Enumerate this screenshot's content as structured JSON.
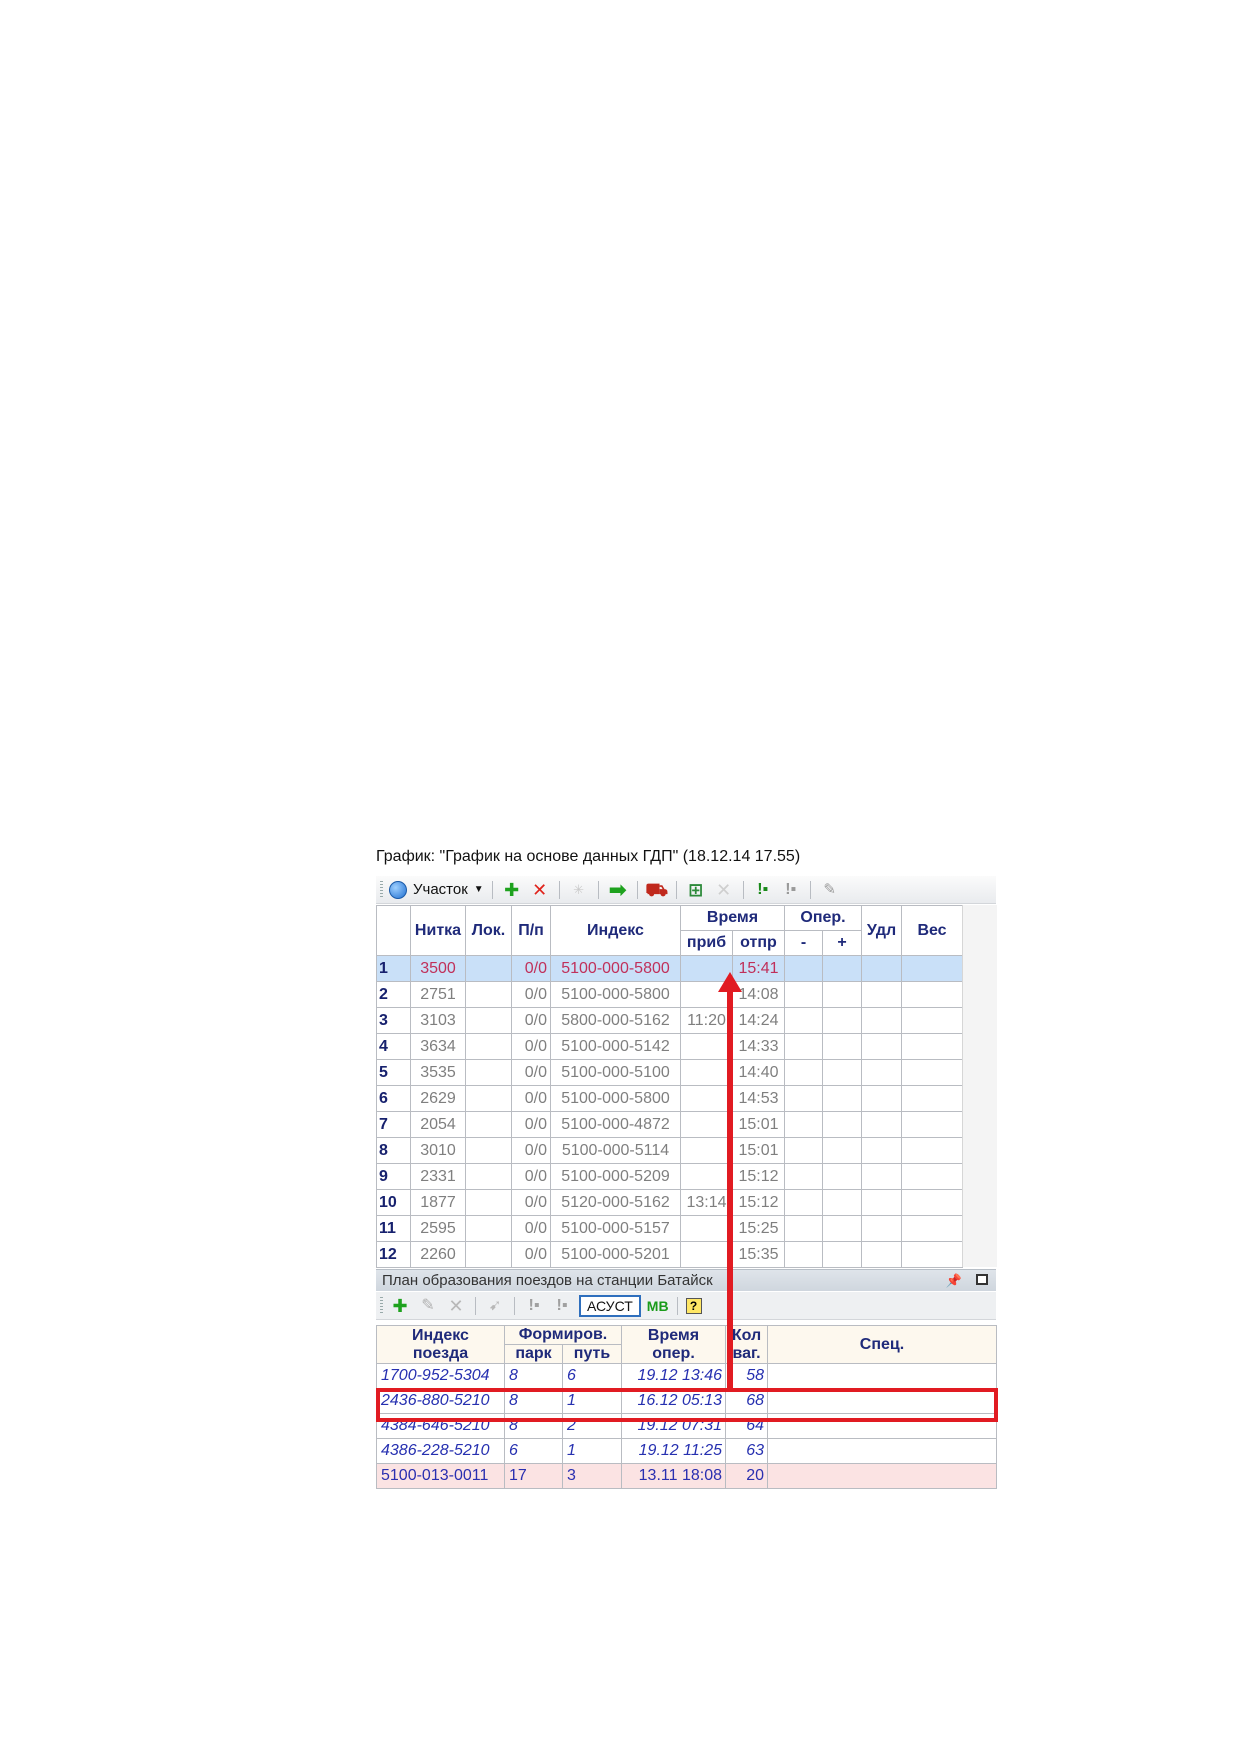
{
  "window": {
    "title": "График: \"График на основе данных ГДП\" (18.12.14 17.55)"
  },
  "toolbar": {
    "section_label": "Участок"
  },
  "trains_table": {
    "headers": {
      "nitka": "Нитка",
      "lok": "Лок.",
      "pp": "П/п",
      "index": "Индекс",
      "time": "Время",
      "arrival": "приб",
      "departure": "отпр",
      "oper": "Опер.",
      "oper_minus": "-",
      "oper_plus": "+",
      "udl": "Удл",
      "ves": "Вес"
    },
    "rows": [
      {
        "num": "1",
        "nitka": "3500",
        "lok": "",
        "pp": "0/0",
        "index": "5100-000-5800",
        "arrival": "",
        "departure": "15:41",
        "minus": "",
        "plus": "",
        "udl": "",
        "ves": ""
      },
      {
        "num": "2",
        "nitka": "2751",
        "lok": "",
        "pp": "0/0",
        "index": "5100-000-5800",
        "arrival": "",
        "departure": "14:08",
        "minus": "",
        "plus": "",
        "udl": "",
        "ves": ""
      },
      {
        "num": "3",
        "nitka": "3103",
        "lok": "",
        "pp": "0/0",
        "index": "5800-000-5162",
        "arrival": "11:20",
        "departure": "14:24",
        "minus": "",
        "plus": "",
        "udl": "",
        "ves": ""
      },
      {
        "num": "4",
        "nitka": "3634",
        "lok": "",
        "pp": "0/0",
        "index": "5100-000-5142",
        "arrival": "",
        "departure": "14:33",
        "minus": "",
        "plus": "",
        "udl": "",
        "ves": ""
      },
      {
        "num": "5",
        "nitka": "3535",
        "lok": "",
        "pp": "0/0",
        "index": "5100-000-5100",
        "arrival": "",
        "departure": "14:40",
        "minus": "",
        "plus": "",
        "udl": "",
        "ves": ""
      },
      {
        "num": "6",
        "nitka": "2629",
        "lok": "",
        "pp": "0/0",
        "index": "5100-000-5800",
        "arrival": "",
        "departure": "14:53",
        "minus": "",
        "plus": "",
        "udl": "",
        "ves": ""
      },
      {
        "num": "7",
        "nitka": "2054",
        "lok": "",
        "pp": "0/0",
        "index": "5100-000-4872",
        "arrival": "",
        "departure": "15:01",
        "minus": "",
        "plus": "",
        "udl": "",
        "ves": ""
      },
      {
        "num": "8",
        "nitka": "3010",
        "lok": "",
        "pp": "0/0",
        "index": "5100-000-5114",
        "arrival": "",
        "departure": "15:01",
        "minus": "",
        "plus": "",
        "udl": "",
        "ves": ""
      },
      {
        "num": "9",
        "nitka": "2331",
        "lok": "",
        "pp": "0/0",
        "index": "5100-000-5209",
        "arrival": "",
        "departure": "15:12",
        "minus": "",
        "plus": "",
        "udl": "",
        "ves": ""
      },
      {
        "num": "10",
        "nitka": "1877",
        "lok": "",
        "pp": "0/0",
        "index": "5120-000-5162",
        "arrival": "13:14",
        "departure": "15:12",
        "minus": "",
        "plus": "",
        "udl": "",
        "ves": ""
      },
      {
        "num": "11",
        "nitka": "2595",
        "lok": "",
        "pp": "0/0",
        "index": "5100-000-5157",
        "arrival": "",
        "departure": "15:25",
        "minus": "",
        "plus": "",
        "udl": "",
        "ves": ""
      },
      {
        "num": "12",
        "nitka": "2260",
        "lok": "",
        "pp": "0/0",
        "index": "5100-000-5201",
        "arrival": "",
        "departure": "15:35",
        "minus": "",
        "plus": "",
        "udl": "",
        "ves": ""
      }
    ]
  },
  "formation_panel": {
    "title": "План образования поездов на станции Батайск",
    "asust_label": "АСУСТ",
    "mb_label": "МВ",
    "help_label": "?",
    "headers": {
      "index_line1": "Индекс",
      "index_line2": "поезда",
      "form": "Формиров.",
      "park": "парк",
      "put": "путь",
      "time_line1": "Время",
      "time_line2": "опер.",
      "kol_line1": "Кол",
      "kol_line2": "ваг.",
      "spec": "Спец."
    },
    "rows": [
      {
        "index": "1700-952-5304",
        "park": "8",
        "put": "6",
        "time": "19.12 13:46",
        "kol": "58",
        "spec": ""
      },
      {
        "index": "2436-880-5210",
        "park": "8",
        "put": "1",
        "time": "16.12 05:13",
        "kol": "68",
        "spec": ""
      },
      {
        "index": "4384-646-5210",
        "park": "8",
        "put": "2",
        "time": "19.12 07:31",
        "kol": "64",
        "spec": ""
      },
      {
        "index": "4386-228-5210",
        "park": "6",
        "put": "1",
        "time": "19.12 11:25",
        "kol": "63",
        "spec": ""
      },
      {
        "index": "5100-013-0011",
        "park": "17",
        "put": "3",
        "time": "13.11 18:08",
        "kol": "20",
        "spec": ""
      }
    ]
  },
  "colors": {
    "highlight": "#e11b22",
    "selected_row": "#c9e0f8",
    "header_text": "#1f2a7a",
    "pink_row": "#fbe3e3"
  }
}
